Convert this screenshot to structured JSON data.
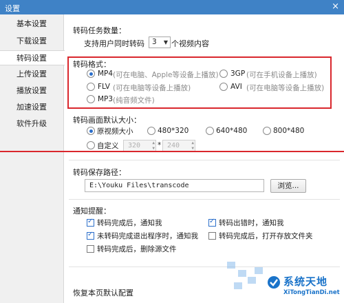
{
  "window": {
    "title": "设置",
    "close_glyph": "×"
  },
  "sidebar": {
    "items": [
      {
        "label": "基本设置"
      },
      {
        "label": "下载设置"
      },
      {
        "label": "转码设置"
      },
      {
        "label": "上传设置"
      },
      {
        "label": "播放设置"
      },
      {
        "label": "加速设置"
      },
      {
        "label": "软件升级"
      }
    ],
    "active_index": 2
  },
  "tasks": {
    "heading": "转码任务数量：",
    "prefix": "支持用户同时转码",
    "count": "3",
    "suffix": "个视频内容"
  },
  "format": {
    "heading": "转码格式：",
    "options": [
      {
        "name": "MP4",
        "hint": "(可在电脑、Apple等设备上播放)",
        "checked": true
      },
      {
        "name": "3GP",
        "hint": "(可在手机设备上播放)",
        "checked": false
      },
      {
        "name": "FLV",
        "hint": "(可在电脑等设备上播放)",
        "checked": false
      },
      {
        "name": "AVI",
        "hint": "(可在电脑等设备上播放)",
        "checked": false
      },
      {
        "name": "MP3",
        "hint": "(纯音频文件)",
        "checked": false
      }
    ]
  },
  "size": {
    "heading": "转码画面默认大小：",
    "options": [
      {
        "label": "原视频大小",
        "checked": true
      },
      {
        "label": "480*320",
        "checked": false
      },
      {
        "label": "640*480",
        "checked": false
      },
      {
        "label": "800*480",
        "checked": false
      },
      {
        "label": "自定义",
        "checked": false
      }
    ],
    "custom_width": "320",
    "times": "*",
    "custom_height": "240"
  },
  "path": {
    "heading": "转码保存路径：",
    "value": "E:\\Youku Files\\transcode",
    "browse_label": "浏览..."
  },
  "notify": {
    "heading": "通知提醒：",
    "items": [
      {
        "label": "转码完成后，通知我",
        "checked": true
      },
      {
        "label": "转码出错时，通知我",
        "checked": true
      },
      {
        "label": "未转码完成退出程序时，通知我",
        "checked": true
      },
      {
        "label": "转码完成后，打开存放文件夹",
        "checked": false
      },
      {
        "label": "转码完成后，删除源文件",
        "checked": false
      }
    ]
  },
  "footer": {
    "restore_label": "恢复本页默认配置"
  },
  "watermark": {
    "title": "系统天地",
    "url": "XiTongTianDi.net"
  },
  "colors": {
    "titlebar": "#3f82c6",
    "highlight": "#d9262c",
    "accent": "#2c6fcb"
  }
}
